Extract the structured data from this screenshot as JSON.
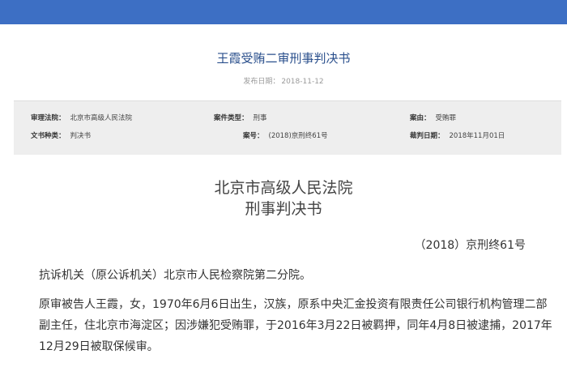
{
  "header": {
    "title": "王霞受贿二审刑事判决书",
    "publish_date_label": "发布日期：",
    "publish_date": "2018-11-12"
  },
  "meta": {
    "court_label": "审理法院：",
    "court": "北京市高级人民法院",
    "case_type_label": "案件类型：",
    "case_type": "刑事",
    "cause_label": "案由：",
    "cause": "受贿罪",
    "doc_type_label": "文书种类：",
    "doc_type": "判决书",
    "case_no_label": "案号：",
    "case_no": "(2018)京刑终61号",
    "judgment_date_label": "裁判日期：",
    "judgment_date": "2018年11月01日"
  },
  "document": {
    "court_name": "北京市高级人民法院",
    "title": "刑事判决书",
    "case_number": "（2018）京刑终61号",
    "paragraphs": [
      "抗诉机关（原公诉机关）北京市人民检察院第二分院。",
      "原审被告人王霞，女，1970年6月6日出生，汉族，原系中央汇金投资有限责任公司银行机构管理二部副主任，住北京市海淀区；因涉嫌犯受贿罪，于2016年3月22日被羁押，同年4月8日被逮捕，2017年12月29日被取保候审。"
    ]
  },
  "colors": {
    "top_bar": "#3d6fc4",
    "title": "#2a4f8c",
    "meta_background": "#eeeeee"
  }
}
